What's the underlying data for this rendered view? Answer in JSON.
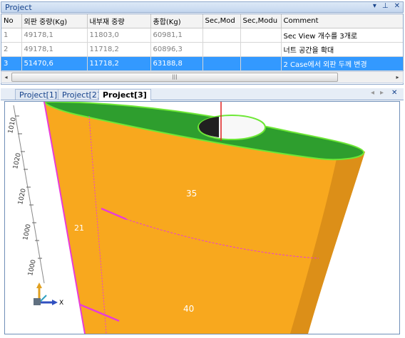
{
  "pane": {
    "title": "Project",
    "btn_menu": "▾",
    "btn_pin": "⊥",
    "btn_close": "✕"
  },
  "grid": {
    "columns": [
      "No",
      "외판 중량(Kg)",
      "내부재 중량",
      "총합(Kg)",
      "Sec,Mod",
      "Sec,Modu",
      "Comment"
    ],
    "rows": [
      [
        "1",
        "49178,1",
        "11803,0",
        "60981,1",
        "",
        "",
        "Sec View 개수를 3개로"
      ],
      [
        "2",
        "49178,1",
        "11718,2",
        "60896,3",
        "",
        "",
        "너트 공간을 확대"
      ],
      [
        "3",
        "51470,6",
        "11718,2",
        "63188,8",
        "",
        "",
        "2 Case에서 외판 두께 변경"
      ]
    ],
    "scroll_thumb": "|||",
    "scroll_left": "◂",
    "scroll_right": "▸"
  },
  "tabs": {
    "items": [
      "Project[1]",
      "Project[2]",
      "Project[3]"
    ],
    "active": 2,
    "prev": "◂",
    "next": "▸",
    "close": "✕"
  },
  "viewport": {
    "ruler_labels": [
      "1010",
      "1020",
      "1020",
      "1000",
      "1000"
    ],
    "face_labels": [
      "35",
      "21",
      "40"
    ],
    "axis_x": "X",
    "colors": {
      "hull": "#f8a81e",
      "top": "#2e9e2e",
      "edge_green": "#6ee836",
      "edge_magenta": "#e83cd8",
      "center_red": "#e02020"
    }
  }
}
